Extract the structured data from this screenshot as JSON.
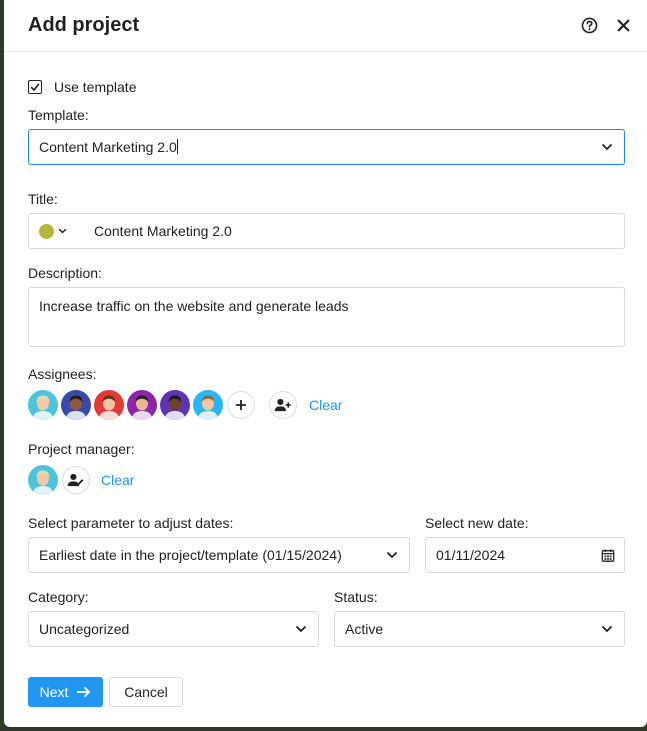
{
  "dialog": {
    "title": "Add project",
    "help_icon": "help-circle-icon",
    "close_icon": "close-icon"
  },
  "template_section": {
    "use_template_label": "Use template",
    "use_template_checked": true,
    "template_label": "Template:",
    "template_value": "Content Marketing 2.0"
  },
  "title_section": {
    "label": "Title:",
    "color": "#b4b83a",
    "value": "Content Marketing 2.0"
  },
  "description_section": {
    "label": "Description:",
    "value": "Increase traffic on the website and generate leads"
  },
  "assignees": {
    "label": "Assignees:",
    "clear_label": "Clear",
    "avatars": [
      {
        "bg": "#4fc3d9",
        "skin": "#f1c9a8",
        "hair": "#e9d7b0"
      },
      {
        "bg": "#3949ab",
        "skin": "#8d5a3b",
        "hair": "#2b1a10"
      },
      {
        "bg": "#e53935",
        "skin": "#f0c4a0",
        "hair": "#5d3a1a"
      },
      {
        "bg": "#8e24aa",
        "skin": "#e6b894",
        "hair": "#222222"
      },
      {
        "bg": "#5e35b1",
        "skin": "#6b4226",
        "hair": "#1a1a1a"
      },
      {
        "bg": "#29b6f6",
        "skin": "#f0c7a3",
        "hair": "#8b6b3f"
      }
    ]
  },
  "project_manager": {
    "label": "Project manager:",
    "clear_label": "Clear",
    "avatar": {
      "bg": "#4fc3d9",
      "skin": "#f1c9a8",
      "hair": "#e9d7b0"
    }
  },
  "dates": {
    "param_label": "Select parameter to adjust dates:",
    "param_value": "Earliest date in the project/template (01/15/2024)",
    "new_date_label": "Select new date:",
    "new_date_value": "01/11/2024"
  },
  "category": {
    "label": "Category:",
    "value": "Uncategorized"
  },
  "status": {
    "label": "Status:",
    "value": "Active"
  },
  "footer": {
    "next_label": "Next",
    "cancel_label": "Cancel"
  },
  "colors": {
    "accent": "#2196f3",
    "focus_border": "#1e88e5"
  }
}
